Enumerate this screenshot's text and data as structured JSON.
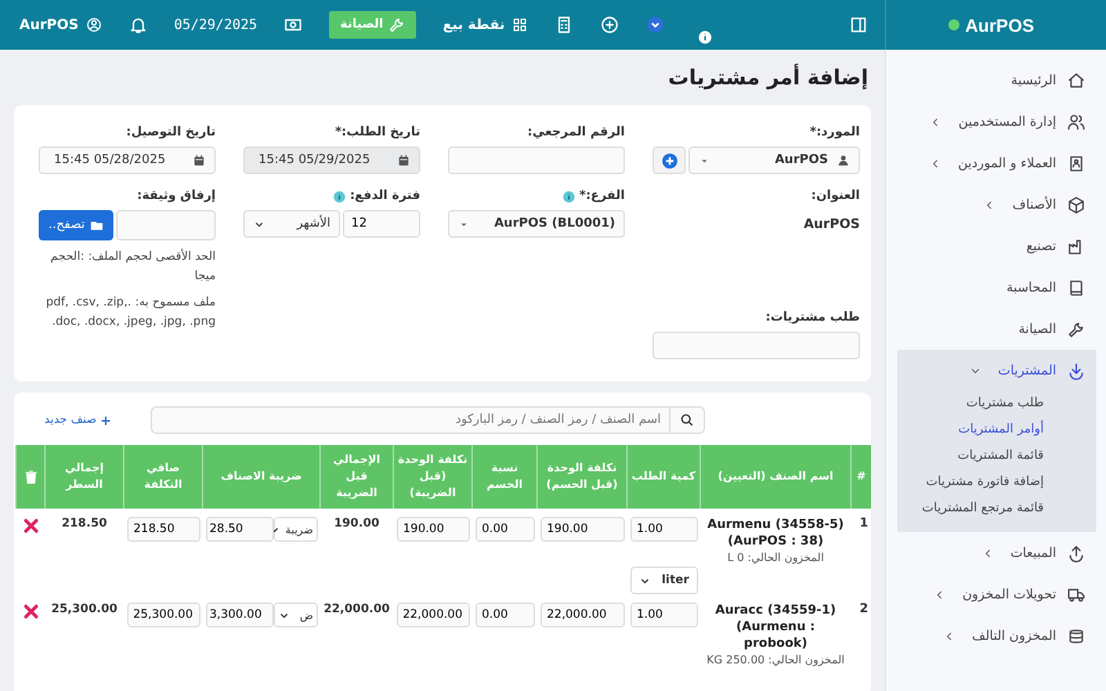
{
  "topbar": {
    "brand": "AurPOS",
    "items": [
      {
        "kind": "icon"
      },
      {
        "kind": "icon"
      },
      {
        "kind": "icon"
      },
      {
        "kind": "icon"
      },
      {
        "kind": "link",
        "label": "نقطة بيع"
      },
      {
        "kind": "button",
        "label": "الصيانة"
      },
      {
        "kind": "icon"
      },
      {
        "kind": "text",
        "label": "05/29/2025"
      },
      {
        "kind": "icon"
      },
      {
        "kind": "link",
        "label": "AurPOS"
      }
    ]
  },
  "sidebar": {
    "items": [
      {
        "label": "الرئيسية",
        "selected": false
      },
      {
        "label": "إدارة المستخدمين",
        "selected": false,
        "expanded": false
      },
      {
        "label": "العملاء و الموردين",
        "selected": false,
        "expanded": false
      },
      {
        "label": "الأصناف",
        "selected": false,
        "expanded": false
      },
      {
        "label": "تصنيع",
        "selected": false
      },
      {
        "label": "المحاسبة",
        "selected": false
      },
      {
        "label": "الصيانة",
        "selected": false
      },
      {
        "label": "المشتريات",
        "selected": true,
        "expanded": true,
        "children": [
          {
            "label": "طلب مشتريات",
            "selected": false
          },
          {
            "label": "أوامر المشتريات",
            "selected": true
          },
          {
            "label": "قائمة المشتريات",
            "selected": false
          },
          {
            "label": "إضافة فاتورة مشتريات",
            "selected": false
          },
          {
            "label": "قائمة مرتجع المشتريات",
            "selected": false
          }
        ]
      },
      {
        "label": "المبيعات",
        "selected": false,
        "expanded": false
      },
      {
        "label": "تحويلات المخزون",
        "selected": false,
        "expanded": false
      },
      {
        "label": "المخزون التالف",
        "selected": false,
        "expanded": false
      }
    ]
  },
  "page_title": "إضافة أمر مشتريات",
  "form": {
    "columns": [
      [
        {
          "kind": "supplier",
          "label": "المورد:*",
          "value": "AurPOS"
        },
        {
          "kind": "static",
          "label": "العنوان:",
          "value": "AurPOS"
        },
        {
          "kind": "input",
          "label": "طلب مشتريات:"
        }
      ],
      [
        {
          "kind": "input",
          "label": "الرقم المرجعي:"
        },
        {
          "kind": "select",
          "label": "الفرع:*",
          "value": "AurPOS (BL0001)",
          "info": true
        }
      ],
      [
        {
          "kind": "date",
          "label": "تاريخ الطلب:*",
          "value": "05/29/2025 15:45",
          "disabled": true
        },
        {
          "kind": "term",
          "label": "فترة الدفع:",
          "value": "12",
          "unit": "الأشهر",
          "info": true
        }
      ],
      [
        {
          "kind": "date",
          "label": "تاريخ التوصيل:",
          "value": "05/28/2025 15:45",
          "disabled": false
        },
        {
          "kind": "file",
          "label": "إرفاق وثيقة:",
          "button": "تصفح..",
          "help": [
            "الحد الأقصى لحجم الملف: :الحجم ميجا",
            "ملف مسموح به: .pdf, .csv, .zip, .doc, .docx, .jpeg, .jpg, .png"
          ]
        }
      ]
    ]
  },
  "items": {
    "search": {
      "placeholder": "اسم الصنف / رمز الصنف / رمز الباركود"
    },
    "add_link": "صنف جديد",
    "table": {
      "columns": [
        "#",
        "اسم الصنف (التعيين)",
        "كمية الطلب",
        "تكلفة الوحدة (قبل الحسم)",
        "نسبة الحسم",
        "تكلفة الوحدة (قبل الضريبة)",
        "الإجمالي قبل الضريبة",
        "ضريبة الاصناف",
        "صافي التكلفة",
        "إجمالي السطر"
      ],
      "rows": [
        {
          "index": "1",
          "name": "Aurmenu (34558-5) (AurPOS : 38)",
          "stock": "المخزون الحالي: 0 L",
          "qty": "1.00",
          "unit": "liter",
          "unit_cost": "190.00",
          "discount": "0.00",
          "cost_before_tax": "190.00",
          "total_before_tax": "190.00",
          "tax_type": "ضريبة",
          "tax": "28.50",
          "net_cost": "218.50",
          "line_total": "218.50"
        },
        {
          "index": "2",
          "name": "Auracc (34559-1) (Aurmenu : probook)",
          "stock": "المخزون الحالي: 250.00 KG",
          "qty": "1.00",
          "unit_cost": "22,000.00",
          "discount": "0.00",
          "cost_before_tax": "22,000.00",
          "total_before_tax": "22,000.00",
          "tax_type": "ض",
          "tax": "3,300.00",
          "net_cost": "25,300.00",
          "line_total": "25,300.00"
        }
      ]
    }
  }
}
